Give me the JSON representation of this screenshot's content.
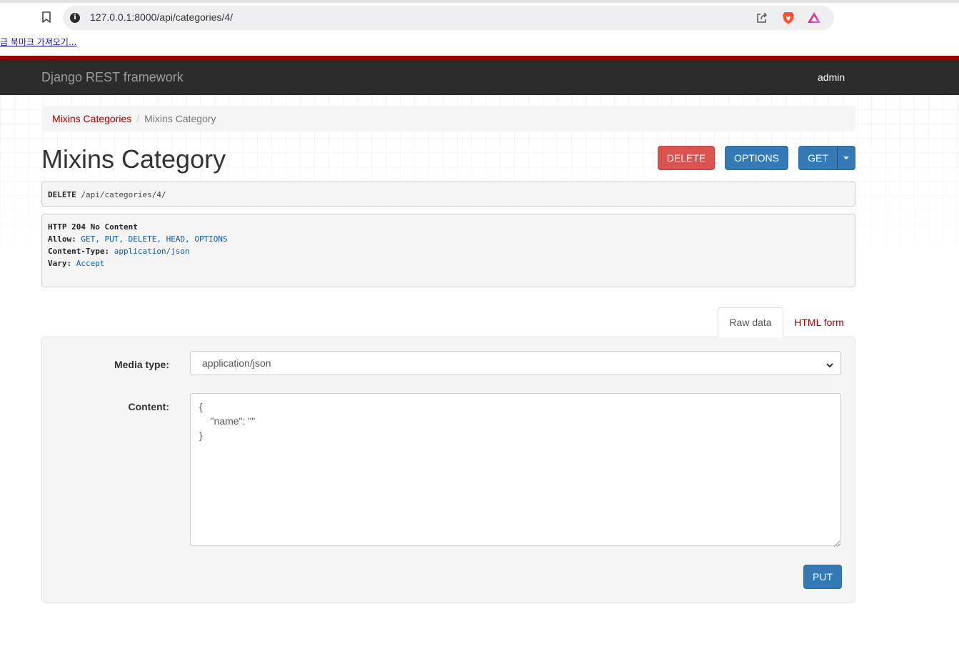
{
  "browser": {
    "url": "127.0.0.1:8000/api/categories/4/",
    "bookmarks_import_label": "금 북마크 가져오기..."
  },
  "navbar": {
    "brand": "Django REST framework",
    "user": "admin"
  },
  "breadcrumb": {
    "items": [
      {
        "label": "Mixins Categories",
        "link": true
      },
      {
        "label": "Mixins Category",
        "link": false
      }
    ],
    "separator": "/"
  },
  "page": {
    "title": "Mixins Category",
    "buttons": {
      "delete": "DELETE",
      "options": "OPTIONS",
      "get": "GET"
    }
  },
  "request": {
    "method": "DELETE",
    "path": "/api/categories/4/"
  },
  "response": {
    "status_line": "HTTP 204 No Content",
    "headers": [
      {
        "name": "Allow:",
        "value": "GET, PUT, DELETE, HEAD, OPTIONS"
      },
      {
        "name": "Content-Type:",
        "value": "application/json"
      },
      {
        "name": "Vary:",
        "value": "Accept"
      }
    ]
  },
  "tabs": {
    "raw": "Raw data",
    "html": "HTML form",
    "active": "raw"
  },
  "form": {
    "media_type_label": "Media type:",
    "media_type_value": "application/json",
    "content_label": "Content:",
    "content_value": "{\n    \"name\": \"\"\n}",
    "submit": "PUT"
  },
  "colors": {
    "navbar_bg": "#2c2c2c",
    "navbar_accent": "#a30000",
    "danger": "#d9534f",
    "primary": "#337ab7",
    "link": "#a30000"
  }
}
